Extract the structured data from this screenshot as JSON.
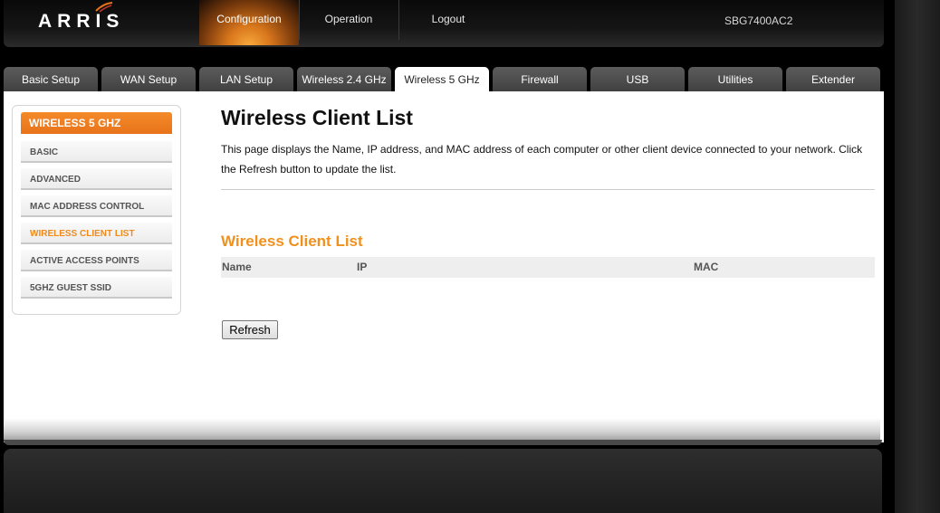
{
  "brand": {
    "logo_text": "ARRIS",
    "model": "SBG7400AC2"
  },
  "topnav": {
    "items": [
      {
        "label": "Configuration",
        "active": true
      },
      {
        "label": "Operation",
        "active": false
      },
      {
        "label": "Logout",
        "active": false
      }
    ]
  },
  "tabs": [
    {
      "label": "Basic Setup"
    },
    {
      "label": "WAN Setup"
    },
    {
      "label": "LAN Setup"
    },
    {
      "label": "Wireless 2.4 GHz"
    },
    {
      "label": "Wireless 5 GHz",
      "active": true
    },
    {
      "label": "Firewall"
    },
    {
      "label": "USB"
    },
    {
      "label": "Utilities"
    },
    {
      "label": "Extender"
    }
  ],
  "sidebar": {
    "title": "WIRELESS 5 GHZ",
    "items": [
      {
        "label": "BASIC"
      },
      {
        "label": "ADVANCED"
      },
      {
        "label": "MAC ADDRESS CONTROL"
      },
      {
        "label": "WIRELESS CLIENT LIST",
        "active": true
      },
      {
        "label": "ACTIVE ACCESS POINTS"
      },
      {
        "label": "5GHZ GUEST SSID"
      }
    ]
  },
  "main": {
    "title": "Wireless Client List",
    "description": "This page displays the Name, IP address, and MAC address of each computer or other client device connected to your network. Click the Refresh button to update the list.",
    "section_title": "Wireless Client List",
    "table": {
      "columns": [
        "Name",
        "IP",
        "MAC"
      ],
      "rows": []
    },
    "refresh_label": "Refresh"
  },
  "colors": {
    "accent": "#f0901e",
    "header_bg": "#111111",
    "tab_bg": "#4a4a4a"
  }
}
